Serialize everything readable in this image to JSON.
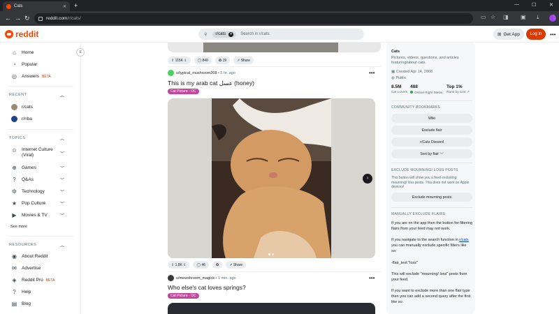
{
  "browser": {
    "tab_title": "Cats",
    "url_host": "reddit.com",
    "url_path": "/r/cats/",
    "profile_initial": "b"
  },
  "header": {
    "logo_text": "reddit",
    "search_chip": "r/cats",
    "search_placeholder": "Search in r/cats",
    "get_app": "Get App",
    "login": "Log In"
  },
  "sidebar": {
    "home": "Home",
    "popular": "Popular",
    "answers": "Answers",
    "beta": "BETA",
    "recent_heading": "RECENT",
    "recent": [
      "r/cats",
      "r/nba"
    ],
    "topics_heading": "TOPICS",
    "topics": [
      "Internet Culture (Viral)",
      "Games",
      "Q&As",
      "Technology",
      "Pop Culture",
      "Movies & TV"
    ],
    "see_more": "See more",
    "resources_heading": "RESOURCES",
    "resources": [
      "About Reddit",
      "Advertise",
      "Reddit Pro",
      "Help",
      "Blog"
    ],
    "reddit_pro_beta": "BETA"
  },
  "feed": {
    "prev_actions": {
      "votes": "115K",
      "comments": "840",
      "awards": "19",
      "share": "Share"
    },
    "post1": {
      "user": "u/typical_mushroom268",
      "time": "5 hr. ago",
      "title": "This is my arab cat عسل (honey)",
      "flair": "Cat Picture - OC",
      "votes": "1.8K",
      "comments": "46",
      "share": "Share"
    },
    "post2": {
      "user": "u/mewshroom_magick",
      "time": "1 min. ago",
      "title": "Who else's cat loves springs?",
      "flair": "Cat Picture - OC"
    }
  },
  "about": {
    "name": "Cats",
    "description": "Pictures, videos, questions, and articles featuring/about cats.",
    "created": "Created Apr 14, 2008",
    "visibility": "Public",
    "members_value": "8.5M",
    "members_label": "Cat Lovers",
    "online_value": "488",
    "online_label": "Online Right Meow",
    "rank_value": "Top 1%",
    "rank_label": "Rank by size",
    "bookmarks_heading": "COMMUNITY BOOKMARKS",
    "bookmarks": [
      "Wiki",
      "Exclude flair",
      "r/Cats Discord",
      "Sort by flair"
    ],
    "exclude_heading": "EXCLUDE MOURNING/ LOSS POSTS",
    "exclude_text": "This button will show you a feed excluding mourning/ loss posts. This does not work on Apple devices!",
    "exclude_button": "Exclude mourning posts",
    "manual_heading": "MANUALLY EXCLUDE FLAIRS",
    "manual_p1": "If you are on the app then the button for filtering flairs from your feed may not work.",
    "manual_p2a": "If you navigate to the search function in ",
    "manual_p2link": "r/cats",
    "manual_p2b": " you can manually exclude specific filters like so:",
    "manual_code": "-flair_text:\"loss\"",
    "manual_p3": "This will exclude \"mourning/ loss\" posts from your feed.",
    "manual_p4": "If you want to exclude more than one flair type then you can add a second query after the first like so:"
  },
  "colors": {
    "accent": "#ff4500",
    "login": "#d93a00",
    "flair": "#c3459d"
  }
}
